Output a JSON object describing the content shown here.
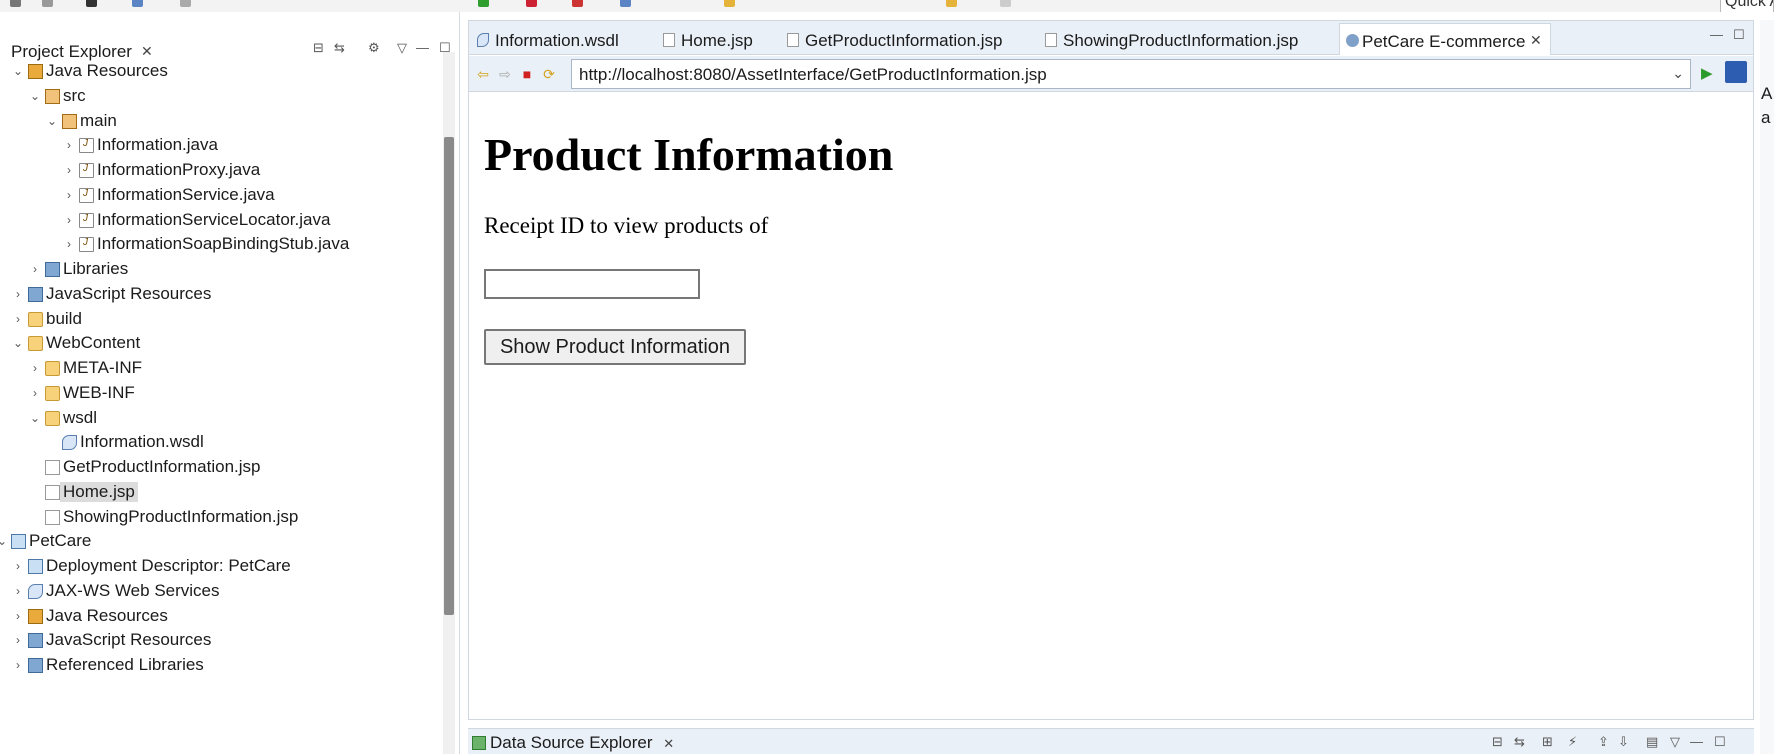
{
  "toolbar": {
    "quick_access": "Quick Access"
  },
  "project_explorer": {
    "title": "Project Explorer",
    "tree": [
      {
        "label": "Java Resources",
        "icon": "java-resources-icon",
        "expanded": true
      },
      {
        "label": "src",
        "icon": "source-folder-icon",
        "expanded": true
      },
      {
        "label": "main",
        "icon": "package-icon",
        "expanded": true
      },
      {
        "label": "Information.java",
        "icon": "java-interface-icon"
      },
      {
        "label": "InformationProxy.java",
        "icon": "java-file-icon"
      },
      {
        "label": "InformationService.java",
        "icon": "java-interface-icon"
      },
      {
        "label": "InformationServiceLocator.java",
        "icon": "java-file-icon"
      },
      {
        "label": "InformationSoapBindingStub.java",
        "icon": "java-file-icon"
      },
      {
        "label": "Libraries",
        "icon": "libraries-icon"
      },
      {
        "label": "JavaScript Resources",
        "icon": "javascript-resources-icon"
      },
      {
        "label": "build",
        "icon": "folder-icon"
      },
      {
        "label": "WebContent",
        "icon": "folder-icon",
        "expanded": true
      },
      {
        "label": "META-INF",
        "icon": "folder-icon"
      },
      {
        "label": "WEB-INF",
        "icon": "folder-icon"
      },
      {
        "label": "wsdl",
        "icon": "folder-icon",
        "expanded": true
      },
      {
        "label": "Information.wsdl",
        "icon": "wsdl-file-icon"
      },
      {
        "label": "GetProductInformation.jsp",
        "icon": "jsp-file-icon"
      },
      {
        "label": "Home.jsp",
        "icon": "jsp-file-icon",
        "selected": true
      },
      {
        "label": "ShowingProductInformation.jsp",
        "icon": "jsp-file-icon"
      },
      {
        "label": "PetCare",
        "icon": "web-project-icon",
        "expanded": true
      },
      {
        "label": "Deployment Descriptor: PetCare",
        "icon": "deployment-descriptor-icon"
      },
      {
        "label": "JAX-WS Web Services",
        "icon": "web-services-icon"
      },
      {
        "label": "Java Resources",
        "icon": "java-resources-icon"
      },
      {
        "label": "JavaScript Resources",
        "icon": "javascript-resources-icon"
      },
      {
        "label": "Referenced Libraries",
        "icon": "libraries-icon"
      }
    ]
  },
  "editor": {
    "tabs": [
      {
        "label": "Information.wsdl",
        "icon": "wsdl-file-icon"
      },
      {
        "label": "Home.jsp",
        "icon": "jsp-file-icon"
      },
      {
        "label": "GetProductInformation.jsp",
        "icon": "jsp-file-icon"
      },
      {
        "label": "ShowingProductInformation.jsp",
        "icon": "jsp-file-icon"
      },
      {
        "label": "PetCare E-commerce",
        "icon": "globe-icon",
        "active": true
      }
    ],
    "url": "http://localhost:8080/AssetInterface/GetProductInformation.jsp"
  },
  "page": {
    "heading": "Product Information",
    "receipt_label": "Receipt ID to view products of",
    "receipt_value": "",
    "button_label": "Show Product Information"
  },
  "bottom_panel": {
    "tab_label": "Data Source Explorer"
  },
  "right_edge": {
    "line1": "A",
    "line2": "a"
  },
  "colors": {
    "panel_bg": "#eaf0f7",
    "border": "#cfd7e1",
    "selection": "#dcdcdc"
  }
}
